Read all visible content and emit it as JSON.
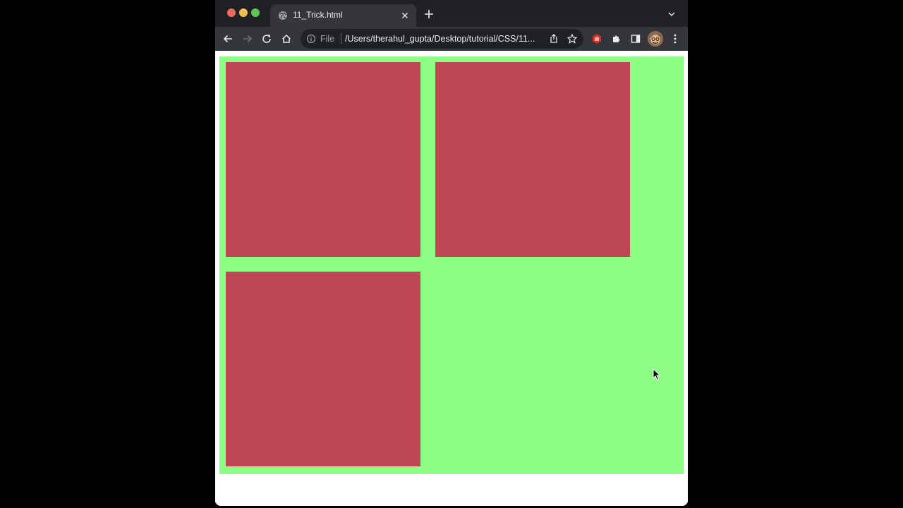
{
  "browser": {
    "tab": {
      "title": "11_Trick.html",
      "favicon": "globe-icon",
      "close": "close-icon"
    },
    "new_tab": "plus-icon",
    "tab_search": "chevron-down-icon",
    "nav": {
      "back": "arrow-left-icon",
      "forward": "arrow-right-icon",
      "reload": "reload-icon",
      "home": "home-icon"
    },
    "omnibox": {
      "info_icon": "info-icon",
      "scheme": "File",
      "url": "/Users/therahul_gupta/Desktop/tutorial/CSS/11...",
      "share_icon": "share-icon",
      "bookmark_icon": "star-icon"
    },
    "extensions": [
      "hand-stop-extension-icon",
      "puzzle-extensions-icon",
      "side-panel-icon"
    ],
    "profile": "avatar",
    "menu": "kebab-menu-icon"
  },
  "page": {
    "container_color": "#8dfc84",
    "box_color": "#bf4755",
    "boxes": [
      "box-1",
      "box-2",
      "box-3"
    ]
  },
  "colors": {
    "tabstrip": "#202124",
    "toolbar": "#35363a",
    "omnibox": "#202124"
  }
}
